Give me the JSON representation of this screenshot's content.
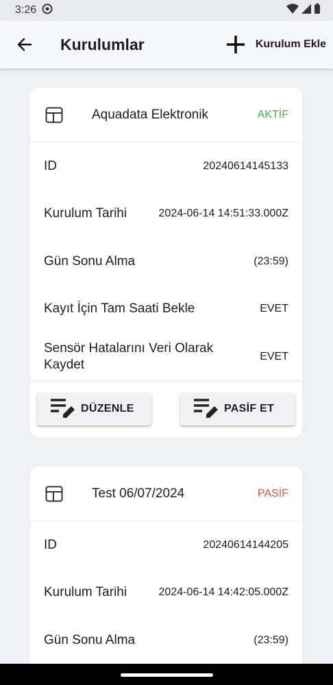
{
  "status_bar": {
    "time": "3:26"
  },
  "appbar": {
    "title": "Kurulumlar",
    "add_label": "Kurulum Ekle"
  },
  "colors": {
    "active": "#4caf50",
    "passive": "#e5533d"
  },
  "cards": [
    {
      "name": "Aquadata Elektronik",
      "status": "AKTİF",
      "rows": [
        {
          "label": "ID",
          "value": "20240614145133"
        },
        {
          "label": "Kurulum Tarihi",
          "value": "2024-06-14 14:51:33.000Z"
        },
        {
          "label": "Gün Sonu Alma",
          "value": "(23:59)"
        },
        {
          "label": "Kayıt İçin Tam Saati Bekle",
          "value": "EVET"
        },
        {
          "label": "Sensör Hatalarını Veri Olarak Kaydet",
          "value": "EVET"
        }
      ],
      "edit_label": "DÜZENLE",
      "toggle_label": "PASİF ET"
    },
    {
      "name": "Test 06/07/2024",
      "status": "PASİF",
      "rows": [
        {
          "label": "ID",
          "value": "20240614144205"
        },
        {
          "label": "Kurulum Tarihi",
          "value": "2024-06-14 14:42:05.000Z"
        },
        {
          "label": "Gün Sonu Alma",
          "value": "(23:59)"
        }
      ]
    }
  ]
}
